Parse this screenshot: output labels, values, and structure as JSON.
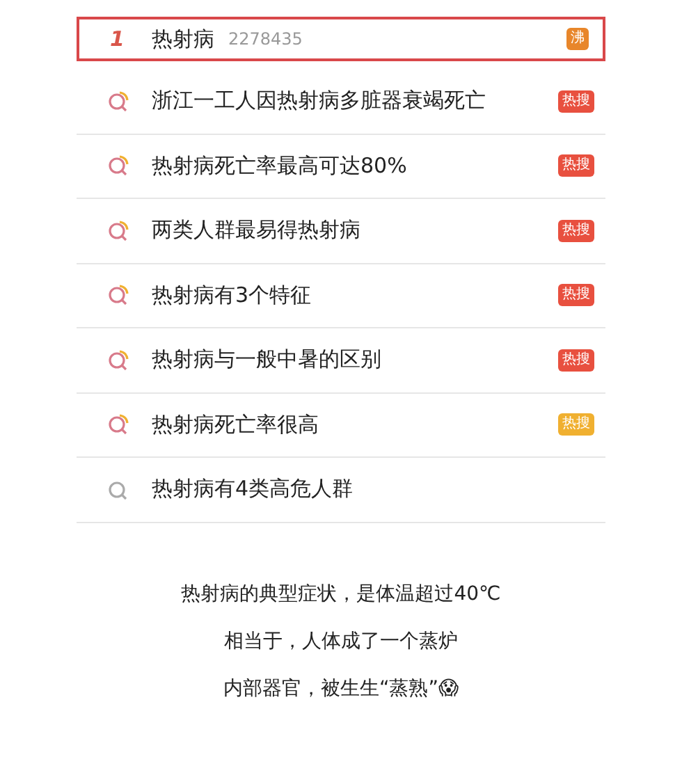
{
  "top_item": {
    "rank": "1",
    "title": "热射病",
    "count": "2278435",
    "badge": {
      "text": "沸",
      "color": "#e8862a"
    }
  },
  "items": [
    {
      "title": "浙江一工人因热射病多脏器衰竭死亡",
      "kind": "trending",
      "badge": {
        "text": "热搜",
        "color": "#e8503f"
      }
    },
    {
      "title": "热射病死亡率最高可达80%",
      "kind": "trending",
      "badge": {
        "text": "热搜",
        "color": "#e8503f"
      }
    },
    {
      "title": "两类人群最易得热射病",
      "kind": "trending",
      "badge": {
        "text": "热搜",
        "color": "#e8503f"
      }
    },
    {
      "title": "热射病有3个特征",
      "kind": "trending",
      "badge": {
        "text": "热搜",
        "color": "#e8503f"
      }
    },
    {
      "title": "热射病与一般中暑的区别",
      "kind": "trending",
      "badge": {
        "text": "热搜",
        "color": "#e8503f"
      }
    },
    {
      "title": "热射病死亡率很高",
      "kind": "trending",
      "badge": {
        "text": "热搜",
        "color": "#f0b030"
      }
    },
    {
      "title": "热射病有4类高危人群",
      "kind": "plain"
    }
  ],
  "caption": [
    "热射病的典型症状，是体温超过40℃",
    "相当于，人体成了一个蒸炉",
    "内部器官，被生生“蒸熟”😱"
  ]
}
